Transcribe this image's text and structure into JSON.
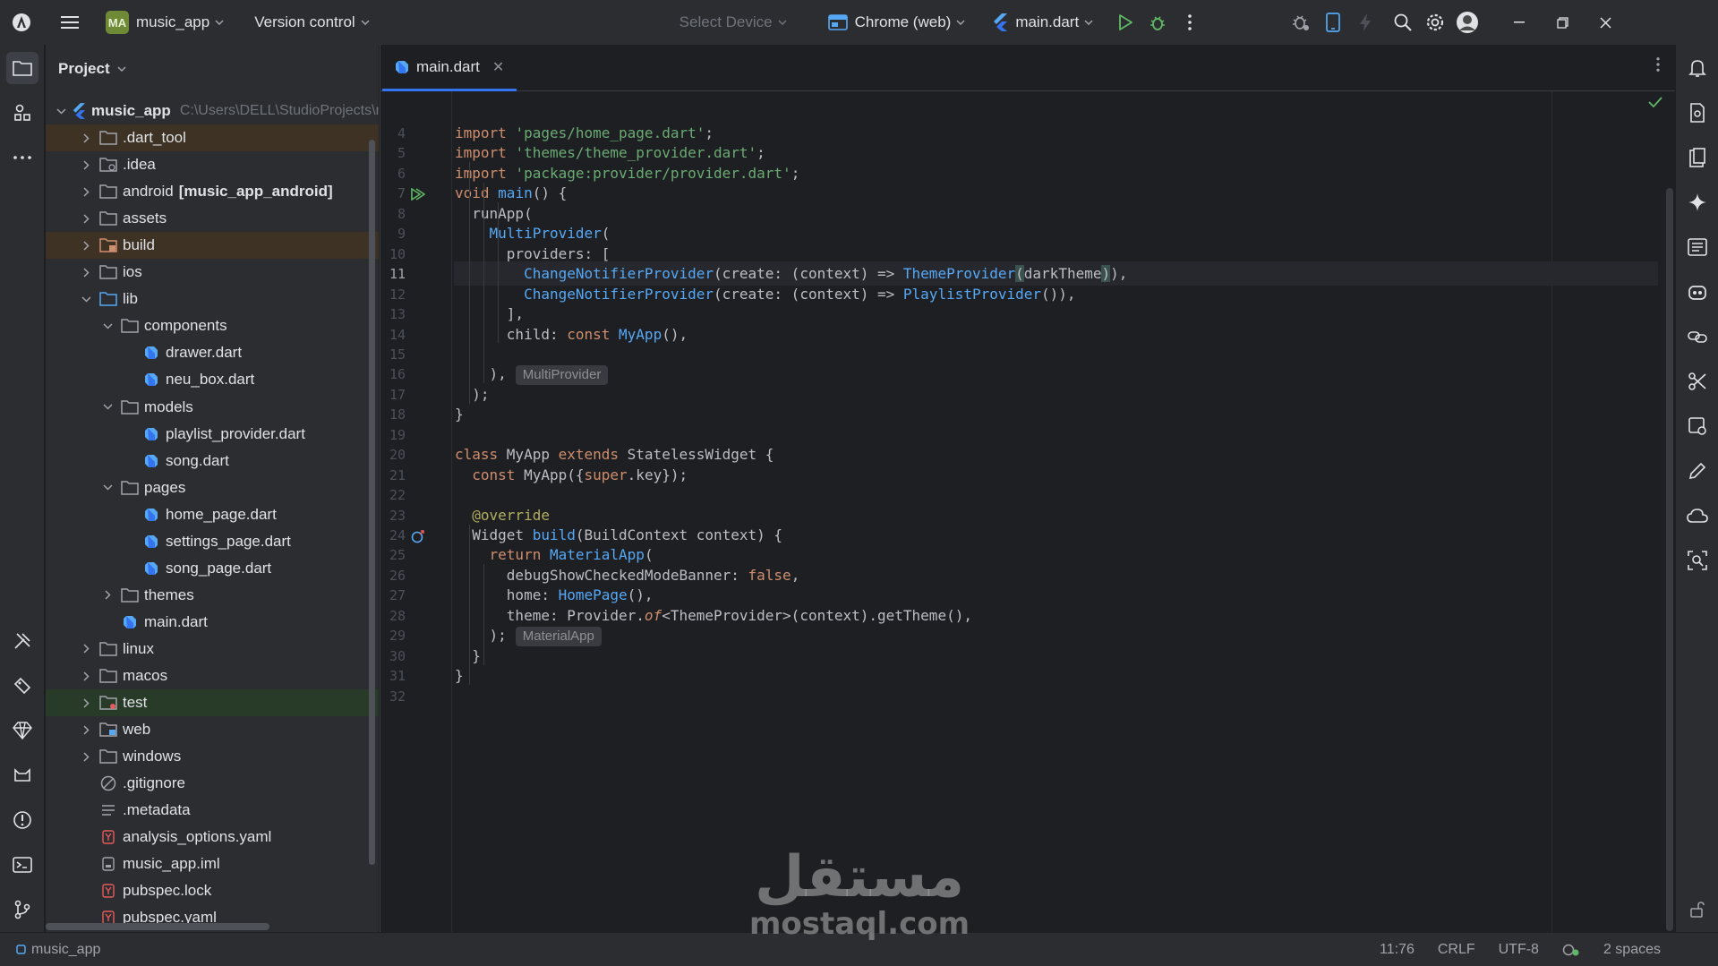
{
  "titlebar": {
    "project_badge": "MA",
    "project_name": "music_app",
    "vcs_label": "Version control",
    "device_placeholder": "Select Device",
    "target_device": "Chrome (web)",
    "run_config": "main.dart"
  },
  "project_panel": {
    "title": "Project",
    "root_name": "music_app",
    "root_path": "C:\\Users\\DELL\\StudioProjects\\music_app",
    "items": [
      {
        "label": ".dart_tool",
        "kind": "folder",
        "depth": 1,
        "twisty": "collapsed",
        "highlight": "brown"
      },
      {
        "label": ".idea",
        "kind": "folder-config",
        "depth": 1,
        "twisty": "collapsed"
      },
      {
        "label": "android",
        "suffix": "[music_app_android]",
        "kind": "folder",
        "depth": 1,
        "twisty": "collapsed"
      },
      {
        "label": "assets",
        "kind": "folder",
        "depth": 1,
        "twisty": "collapsed"
      },
      {
        "label": "build",
        "kind": "folder-excluded",
        "depth": 1,
        "twisty": "collapsed",
        "highlight": "brown"
      },
      {
        "label": "ios",
        "kind": "folder",
        "depth": 1,
        "twisty": "collapsed"
      },
      {
        "label": "lib",
        "kind": "folder-source",
        "depth": 1,
        "twisty": "expanded"
      },
      {
        "label": "components",
        "kind": "folder",
        "depth": 2,
        "twisty": "expanded"
      },
      {
        "label": "drawer.dart",
        "kind": "dart",
        "depth": 3
      },
      {
        "label": "neu_box.dart",
        "kind": "dart",
        "depth": 3
      },
      {
        "label": "models",
        "kind": "folder",
        "depth": 2,
        "twisty": "expanded"
      },
      {
        "label": "playlist_provider.dart",
        "kind": "dart",
        "depth": 3
      },
      {
        "label": "song.dart",
        "kind": "dart",
        "depth": 3
      },
      {
        "label": "pages",
        "kind": "folder",
        "depth": 2,
        "twisty": "expanded"
      },
      {
        "label": "home_page.dart",
        "kind": "dart",
        "depth": 3
      },
      {
        "label": "settings_page.dart",
        "kind": "dart",
        "depth": 3
      },
      {
        "label": "song_page.dart",
        "kind": "dart",
        "depth": 3
      },
      {
        "label": "themes",
        "kind": "folder",
        "depth": 2,
        "twisty": "collapsed"
      },
      {
        "label": "main.dart",
        "kind": "dart",
        "depth": 2
      },
      {
        "label": "linux",
        "kind": "folder",
        "depth": 1,
        "twisty": "collapsed"
      },
      {
        "label": "macos",
        "kind": "folder",
        "depth": 1,
        "twisty": "collapsed"
      },
      {
        "label": "test",
        "kind": "folder-test",
        "depth": 1,
        "twisty": "collapsed",
        "highlight": "green"
      },
      {
        "label": "web",
        "kind": "folder-web",
        "depth": 1,
        "twisty": "collapsed"
      },
      {
        "label": "windows",
        "kind": "folder",
        "depth": 1,
        "twisty": "collapsed"
      },
      {
        "label": ".gitignore",
        "kind": "ignore",
        "depth": 1
      },
      {
        "label": ".metadata",
        "kind": "text",
        "depth": 1
      },
      {
        "label": "analysis_options.yaml",
        "kind": "yaml",
        "depth": 1
      },
      {
        "label": "music_app.iml",
        "kind": "iml",
        "depth": 1
      },
      {
        "label": "pubspec.lock",
        "kind": "yaml",
        "depth": 1
      },
      {
        "label": "pubspec.yaml",
        "kind": "yaml",
        "depth": 1
      }
    ]
  },
  "editor": {
    "tab_label": "main.dart",
    "current_line": 11,
    "lines": [
      {
        "n": 4,
        "segs": [
          [
            "import ",
            "kw"
          ],
          [
            "'pages/home_page.dart'",
            "str"
          ],
          [
            ";",
            ""
          ]
        ]
      },
      {
        "n": 5,
        "segs": [
          [
            "import ",
            "kw"
          ],
          [
            "'themes/theme_provider.dart'",
            "str"
          ],
          [
            ";",
            ""
          ]
        ]
      },
      {
        "n": 6,
        "segs": [
          [
            "import ",
            "kw"
          ],
          [
            "'package:provider/provider.dart'",
            "str"
          ],
          [
            ";",
            ""
          ]
        ]
      },
      {
        "n": 7,
        "run": true,
        "segs": [
          [
            "void ",
            "kw"
          ],
          [
            "main",
            "fn"
          ],
          [
            "() {",
            ""
          ]
        ]
      },
      {
        "n": 8,
        "segs": [
          [
            "  runApp(",
            ""
          ]
        ]
      },
      {
        "n": 9,
        "segs": [
          [
            "    ",
            ""
          ],
          [
            "MultiProvider",
            "cls"
          ],
          [
            "(",
            ""
          ]
        ]
      },
      {
        "n": 10,
        "segs": [
          [
            "      providers: [",
            ""
          ]
        ]
      },
      {
        "n": 11,
        "segs": [
          [
            "        ",
            ""
          ],
          [
            "ChangeNotifierProvider",
            "cls"
          ],
          [
            "(create: (context) => ",
            ""
          ],
          [
            "ThemeProvider",
            "cls"
          ],
          [
            "(",
            "bracket"
          ],
          [
            "darkTheme",
            ""
          ],
          [
            ")",
            "bracket"
          ],
          [
            ")",
            ""
          ],
          [
            ",",
            ""
          ]
        ]
      },
      {
        "n": 12,
        "segs": [
          [
            "        ",
            ""
          ],
          [
            "ChangeNotifierProvider",
            "cls"
          ],
          [
            "(create: (context) => ",
            ""
          ],
          [
            "PlaylistProvider",
            "cls"
          ],
          [
            "()),",
            ""
          ]
        ]
      },
      {
        "n": 13,
        "segs": [
          [
            "      ],",
            ""
          ]
        ]
      },
      {
        "n": 14,
        "segs": [
          [
            "      child: ",
            ""
          ],
          [
            "const ",
            "kw"
          ],
          [
            "MyApp",
            "cls"
          ],
          [
            "(),",
            ""
          ]
        ]
      },
      {
        "n": 15,
        "segs": []
      },
      {
        "n": 16,
        "segs": [
          [
            "    ),",
            ""
          ]
        ],
        "hint": "MultiProvider"
      },
      {
        "n": 17,
        "segs": [
          [
            "  );",
            ""
          ]
        ]
      },
      {
        "n": 18,
        "segs": [
          [
            "}",
            ""
          ]
        ]
      },
      {
        "n": 19,
        "segs": []
      },
      {
        "n": 20,
        "segs": [
          [
            "class ",
            "kw"
          ],
          [
            "MyApp ",
            ""
          ],
          [
            "extends ",
            "kw"
          ],
          [
            "StatelessWidget {",
            ""
          ]
        ]
      },
      {
        "n": 21,
        "segs": [
          [
            "  ",
            ""
          ],
          [
            "const ",
            "kw"
          ],
          [
            "MyApp({",
            ""
          ],
          [
            "super",
            "kw"
          ],
          [
            ".key});",
            ""
          ]
        ]
      },
      {
        "n": 22,
        "segs": []
      },
      {
        "n": 23,
        "segs": [
          [
            "  ",
            ""
          ],
          [
            "@override",
            "ann"
          ]
        ]
      },
      {
        "n": 24,
        "override": true,
        "segs": [
          [
            "  Widget ",
            ""
          ],
          [
            "build",
            "fn"
          ],
          [
            "(BuildContext context) {",
            ""
          ]
        ]
      },
      {
        "n": 25,
        "segs": [
          [
            "    ",
            ""
          ],
          [
            "return ",
            "kw"
          ],
          [
            "MaterialApp",
            "cls"
          ],
          [
            "(",
            ""
          ]
        ]
      },
      {
        "n": 26,
        "segs": [
          [
            "      debugShowCheckedModeBanner: ",
            ""
          ],
          [
            "false",
            "kw"
          ],
          [
            ",",
            ""
          ]
        ]
      },
      {
        "n": 27,
        "segs": [
          [
            "      home: ",
            ""
          ],
          [
            "HomePage",
            "cls"
          ],
          [
            "(),",
            ""
          ]
        ]
      },
      {
        "n": 28,
        "segs": [
          [
            "      theme: Provider.",
            ""
          ],
          [
            "of",
            "it"
          ],
          [
            "<ThemeProvider>(context).getTheme(),",
            ""
          ]
        ]
      },
      {
        "n": 29,
        "segs": [
          [
            "    );",
            ""
          ]
        ],
        "hint": "MaterialApp"
      },
      {
        "n": 30,
        "segs": [
          [
            "  }",
            ""
          ]
        ]
      },
      {
        "n": 31,
        "segs": [
          [
            "}",
            ""
          ]
        ]
      },
      {
        "n": 32,
        "segs": []
      }
    ]
  },
  "statusbar": {
    "breadcrumb": "music_app",
    "cursor": "11:76",
    "line_sep": "CRLF",
    "encoding": "UTF-8",
    "indent": "2 spaces"
  },
  "watermark": {
    "arabic": "مستقل",
    "latin": "mostaql.com"
  },
  "colors": {
    "accent": "#3574f0",
    "keyword": "#cf8e6d",
    "string": "#6aab73",
    "type": "#56a8f5",
    "run_green": "#5fb865"
  }
}
